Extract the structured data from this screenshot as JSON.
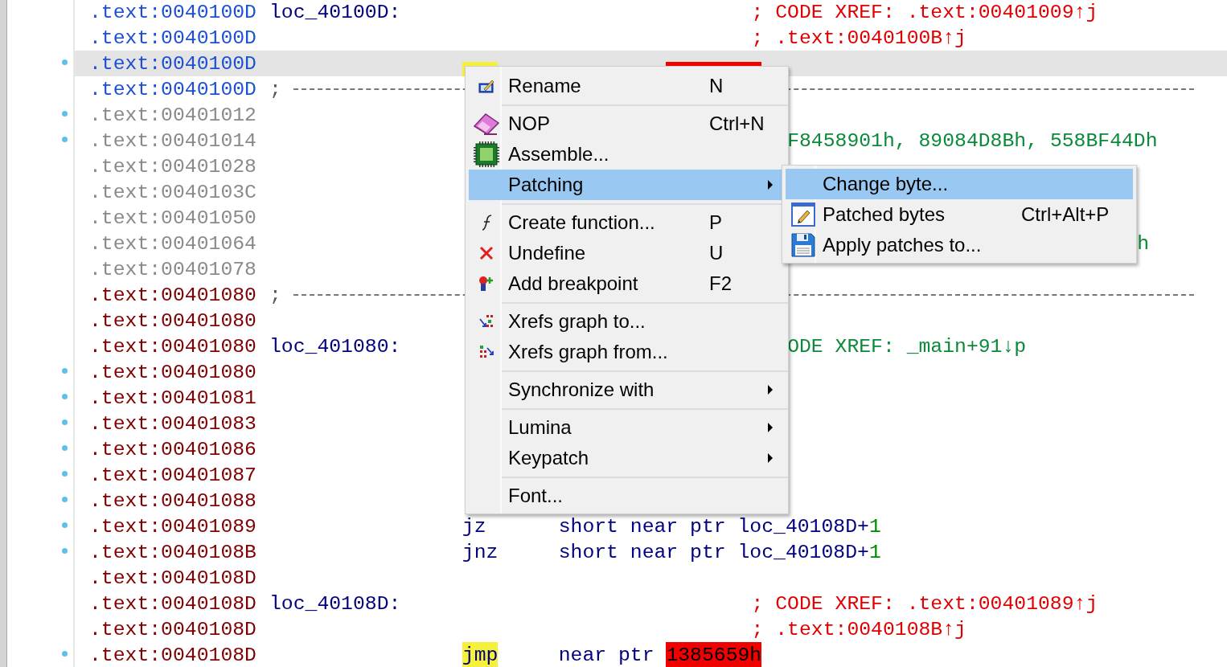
{
  "listing": {
    "rows": [
      {
        "address": ".text:0040100D",
        "color": "#1a4fd6",
        "marked": false,
        "selected": false,
        "label": "loc_40100D:",
        "comment": "; CODE XREF: .text:00401009↑j"
      },
      {
        "address": ".text:0040100D",
        "color": "#1a4fd6",
        "marked": false,
        "selected": false,
        "comment": "; .text:0040100B↑j"
      },
      {
        "address": ".text:0040100D",
        "color": "#1a4fd6",
        "marked": true,
        "selected": true,
        "mnemonic": {
          "highlighted": true
        },
        "operands": [
          {
            "kind": "error"
          }
        ]
      },
      {
        "address": ".text:0040100D",
        "color": "#1a4fd6",
        "marked": false,
        "selected": false,
        "separator": ";"
      },
      {
        "address": ".text:00401012",
        "color": "#8a8a8a",
        "marked": true,
        "selected": false
      },
      {
        "address": ".text:00401014",
        "color": "#8a8a8a",
        "marked": true,
        "selected": false,
        "fragments": [
          {
            "text": "F8458901h, 89084D8Bh, 558BF44Dh",
            "kind": "data"
          }
        ]
      },
      {
        "address": ".text:00401028",
        "color": "#8a8a8a",
        "marked": false,
        "selected": false
      },
      {
        "address": ".text:0040103C",
        "color": "#8a8a8a",
        "marked": false,
        "selected": false
      },
      {
        "address": ".text:00401050",
        "color": "#8a8a8a",
        "marked": false,
        "selected": false
      },
      {
        "address": ".text:00401064",
        "color": "#8a8a8a",
        "marked": false,
        "selected": false,
        "fragments": [
          {
            "text": "h",
            "kind": "data-end"
          }
        ]
      },
      {
        "address": ".text:00401078",
        "color": "#8a8a8a",
        "marked": false,
        "selected": false
      },
      {
        "address": ".text:00401080",
        "color": "#800000",
        "marked": false,
        "selected": false,
        "separator": ";"
      },
      {
        "address": ".text:00401080",
        "color": "#800000",
        "marked": false,
        "selected": false
      },
      {
        "address": ".text:00401080",
        "color": "#800000",
        "marked": false,
        "selected": false,
        "label": "loc_401080:",
        "fragments": [
          {
            "text": "ODE XREF: _main+91↓p",
            "kind": "data"
          }
        ]
      },
      {
        "address": ".text:00401080",
        "color": "#800000",
        "marked": true,
        "selected": false
      },
      {
        "address": ".text:00401081",
        "color": "#800000",
        "marked": true,
        "selected": false
      },
      {
        "address": ".text:00401083",
        "color": "#800000",
        "marked": true,
        "selected": false
      },
      {
        "address": ".text:00401086",
        "color": "#800000",
        "marked": true,
        "selected": false
      },
      {
        "address": ".text:00401087",
        "color": "#800000",
        "marked": true,
        "selected": false
      },
      {
        "address": ".text:00401088",
        "color": "#800000",
        "marked": true,
        "selected": false
      },
      {
        "address": ".text:00401089",
        "color": "#800000",
        "marked": true,
        "selected": false,
        "mnemonic": {
          "text": "jz",
          "highlighted": false
        },
        "operands": [
          {
            "text": "short near ptr loc_40108D+",
            "kind": "name"
          },
          {
            "text": "1",
            "kind": "number"
          }
        ]
      },
      {
        "address": ".text:0040108B",
        "color": "#800000",
        "marked": true,
        "selected": false,
        "mnemonic": {
          "text": "jnz",
          "highlighted": false
        },
        "operands": [
          {
            "text": "short near ptr loc_40108D+",
            "kind": "name"
          },
          {
            "text": "1",
            "kind": "number"
          }
        ]
      },
      {
        "address": ".text:0040108D",
        "color": "#800000",
        "marked": false,
        "selected": false
      },
      {
        "address": ".text:0040108D",
        "color": "#800000",
        "marked": false,
        "selected": false,
        "label": "loc_40108D:",
        "comment": "; CODE XREF: .text:00401089↑j"
      },
      {
        "address": ".text:0040108D",
        "color": "#800000",
        "marked": false,
        "selected": false,
        "comment": "; .text:0040108B↑j"
      },
      {
        "address": ".text:0040108D",
        "color": "#800000",
        "marked": true,
        "selected": false,
        "mnemonic": {
          "text": "jmp",
          "highlighted": true
        },
        "operands": [
          {
            "text": "near ptr ",
            "kind": "name"
          },
          {
            "text": "1385659h",
            "kind": "error"
          }
        ]
      }
    ]
  },
  "context_menu": {
    "items": [
      {
        "kind": "item",
        "label": "Rename",
        "shortcut": "N",
        "submenu": false,
        "selected": false
      },
      {
        "kind": "separator"
      },
      {
        "kind": "item",
        "label": "NOP",
        "shortcut": "Ctrl+N",
        "submenu": false,
        "selected": false
      },
      {
        "kind": "item",
        "label": "Assemble...",
        "submenu": false,
        "selected": false
      },
      {
        "kind": "item",
        "label": "Patching",
        "submenu": true,
        "selected": true
      },
      {
        "kind": "separator"
      },
      {
        "kind": "item",
        "label": "Create function...",
        "shortcut": "P",
        "submenu": false,
        "selected": false
      },
      {
        "kind": "item",
        "label": "Undefine",
        "shortcut": "U",
        "submenu": false,
        "selected": false
      },
      {
        "kind": "item",
        "label": "Add breakpoint",
        "shortcut": "F2",
        "submenu": false,
        "selected": false
      },
      {
        "kind": "separator"
      },
      {
        "kind": "item",
        "label": "Xrefs graph to...",
        "submenu": false,
        "selected": false
      },
      {
        "kind": "item",
        "label": "Xrefs graph from...",
        "submenu": false,
        "selected": false
      },
      {
        "kind": "separator"
      },
      {
        "kind": "item",
        "label": "Synchronize with",
        "submenu": true,
        "selected": false
      },
      {
        "kind": "separator"
      },
      {
        "kind": "item",
        "label": "Lumina",
        "submenu": true,
        "selected": false
      },
      {
        "kind": "item",
        "label": "Keypatch",
        "submenu": true,
        "selected": false
      },
      {
        "kind": "separator"
      },
      {
        "kind": "item",
        "label": "Font...",
        "submenu": false,
        "selected": false
      }
    ]
  },
  "submenu": {
    "items": [
      {
        "kind": "item",
        "label": "Change byte...",
        "submenu": false,
        "selected": true
      },
      {
        "kind": "item",
        "label": "Patched bytes",
        "shortcut": "Ctrl+Alt+P",
        "submenu": false,
        "selected": false
      },
      {
        "kind": "item",
        "label": "Apply patches to...",
        "submenu": false,
        "selected": false
      }
    ]
  }
}
